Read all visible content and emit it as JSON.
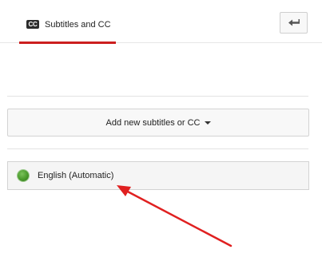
{
  "header": {
    "tab": {
      "badge": "CC",
      "label": "Subtitles and CC"
    },
    "back_button": {
      "icon": "back-arrow-icon"
    }
  },
  "actions": {
    "add_button_label": "Add new subtitles or CC",
    "add_button_icon": "caret-down-icon"
  },
  "tracks": [
    {
      "label": "English (Automatic)",
      "status_icon": "green-status-dot-icon",
      "status_color": "#4a9a2c"
    }
  ],
  "annotation": {
    "arrow_color": "#e02020",
    "arrow_icon": "red-pointer-arrow"
  },
  "colors": {
    "accent": "#cc1f1f"
  }
}
